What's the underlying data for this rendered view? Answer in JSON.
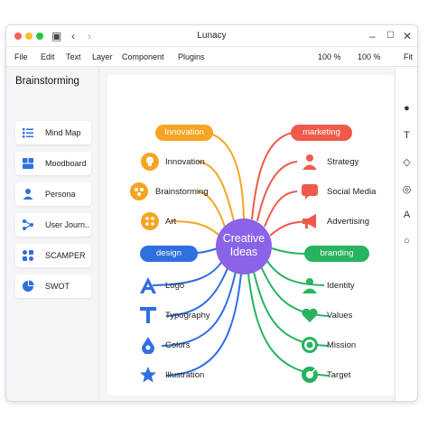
{
  "window": {
    "title": "Lunacy"
  },
  "menu": {
    "file": "File",
    "edit": "Edit",
    "text": "Text",
    "layer": "Layer",
    "component": "Component",
    "plugins": "Plugins",
    "zoom1": "100 %",
    "zoom2": "100 %",
    "fit": "Fit"
  },
  "sidebar": {
    "title": "Brainstorming",
    "items": [
      {
        "label": "Mind Map",
        "icon": "list-icon"
      },
      {
        "label": "Moodboard",
        "icon": "grid-icon"
      },
      {
        "label": "Persona",
        "icon": "person-icon"
      },
      {
        "label": "User Journ...",
        "icon": "flow-icon"
      },
      {
        "label": "SCAMPER",
        "icon": "shapes-icon"
      },
      {
        "label": "SWOT",
        "icon": "pie-icon"
      }
    ]
  },
  "mindmap": {
    "center": {
      "line1": "Creative",
      "line2": "Ideas"
    },
    "categories": {
      "innovation": "Innovation",
      "marketing": "marketing",
      "design": "design",
      "branding": "branding"
    },
    "nodes": {
      "innovation": "Innovation",
      "brainstorming": "Brainstorming",
      "art": "Art",
      "strategy": "Strategy",
      "social": "Social Media",
      "advertising": "Advertising",
      "logo": "Logo",
      "typography": "Typography",
      "colors": "Colors",
      "illustration": "Illustration",
      "identity": "Identity",
      "values": "Values",
      "mission": "Mission",
      "target": "Target"
    }
  },
  "colors": {
    "orange": "#f5a524",
    "red": "#ef5a4a",
    "blue": "#2f6fe0",
    "green": "#27b35f",
    "purple": "#8a63e8"
  }
}
